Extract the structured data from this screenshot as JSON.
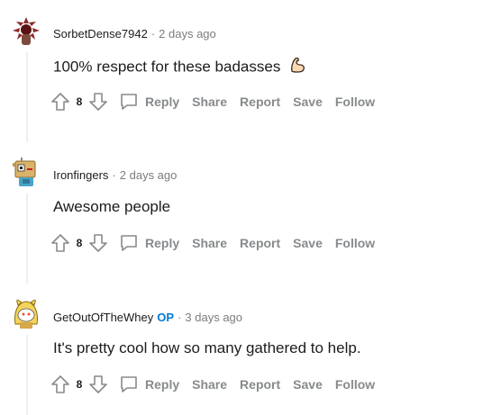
{
  "comments": [
    {
      "author": "SorbetDense7942",
      "op_badge": "",
      "time": "2 days ago",
      "text": "100% respect for these badasses",
      "emoji_icon": "flexed-biceps-icon",
      "score": "8",
      "avatar_icon": "demogorgon-avatar-icon"
    },
    {
      "author": "Ironfingers",
      "op_badge": "",
      "time": "2 days ago",
      "text": "Awesome people",
      "score": "8",
      "avatar_icon": "robot-avatar-icon"
    },
    {
      "author": "GetOutOfTheWhey",
      "op_badge": "OP",
      "time": "3 days ago",
      "text": "It's pretty cool how so many gathered to help.",
      "score": "8",
      "avatar_icon": "snoo-costume-avatar-icon"
    }
  ],
  "actions": {
    "reply": "Reply",
    "share": "Share",
    "report": "Report",
    "save": "Save",
    "follow": "Follow"
  },
  "separator": "·",
  "colors": {
    "muted": "#878a8c",
    "meta": "#7c7c7c",
    "op_blue": "#0079d3",
    "thread_line": "#edeff1"
  }
}
